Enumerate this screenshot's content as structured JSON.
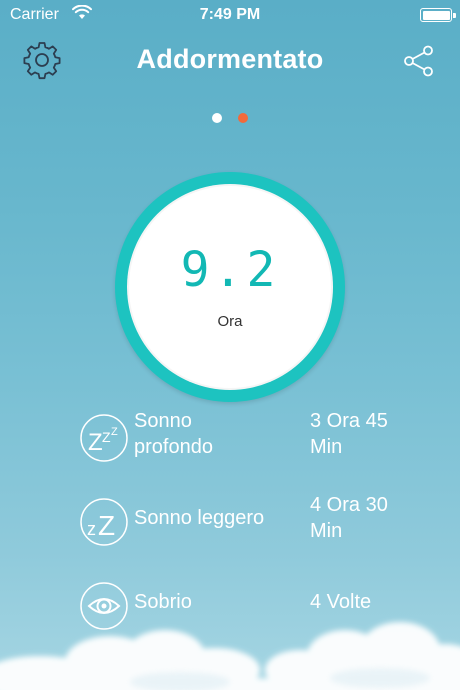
{
  "status_bar": {
    "carrier": "Carrier",
    "time": "7:49 PM"
  },
  "header": {
    "title": "Addormentato",
    "settings_icon": "gear-icon",
    "share_icon": "share-icon"
  },
  "pager": {
    "dot_colors": [
      "#ffffff",
      "#f26a3b"
    ],
    "active_index": 1
  },
  "gauge": {
    "value": "9.2",
    "unit": "Ora",
    "ring_color": "#1dc3c0",
    "value_color": "#12b8b4"
  },
  "stats": [
    {
      "label_line1": "Sonno",
      "label_line2": "profondo",
      "value_line1": "3 Ora 45",
      "value_line2": "Min",
      "icon": "deep-sleep-zzz-icon"
    },
    {
      "label_line1": "Sonno leggero",
      "label_line2": "",
      "value_line1": "4 Ora 30",
      "value_line2": "Min",
      "icon": "light-sleep-zz-icon"
    },
    {
      "label_line1": "Sobrio",
      "label_line2": "",
      "value_line1": "4 Volte",
      "value_line2": "",
      "icon": "eye-icon"
    }
  ]
}
